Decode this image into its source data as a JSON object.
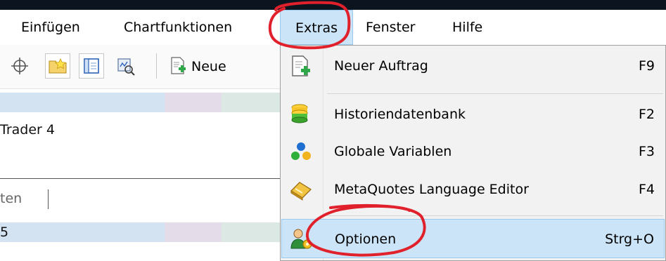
{
  "menubar": {
    "items": [
      {
        "label": "Einfügen"
      },
      {
        "label": "Chartfunktionen"
      },
      {
        "label": "Extras"
      },
      {
        "label": "Fenster"
      },
      {
        "label": "Hilfe"
      }
    ]
  },
  "toolbar": {
    "icons": [
      "crosshair-icon",
      "favorites-folder-icon",
      "navigator-window-icon",
      "strategy-tester-icon"
    ],
    "new_order_label": "Neue"
  },
  "left_panel": {
    "title_fragment": "Trader 4",
    "tab_fragment": "ten",
    "row_fragment": "5"
  },
  "dropdown": {
    "items": [
      {
        "label": "Neuer Auftrag",
        "shortcut": "F9",
        "icon": "new-order-icon"
      },
      {
        "label": "Historiendatenbank",
        "shortcut": "F2",
        "icon": "history-database-icon"
      },
      {
        "label": "Globale Variablen",
        "shortcut": "F3",
        "icon": "global-variables-icon"
      },
      {
        "label": "MetaQuotes Language Editor",
        "shortcut": "F4",
        "icon": "metaeditor-icon"
      },
      {
        "label": "Optionen",
        "shortcut": "Strg+O",
        "icon": "options-icon"
      }
    ]
  },
  "colors": {
    "menu_highlight": "#cce4f7",
    "menu_highlight_border": "#99c9ef",
    "annotation": "#e0202a"
  }
}
